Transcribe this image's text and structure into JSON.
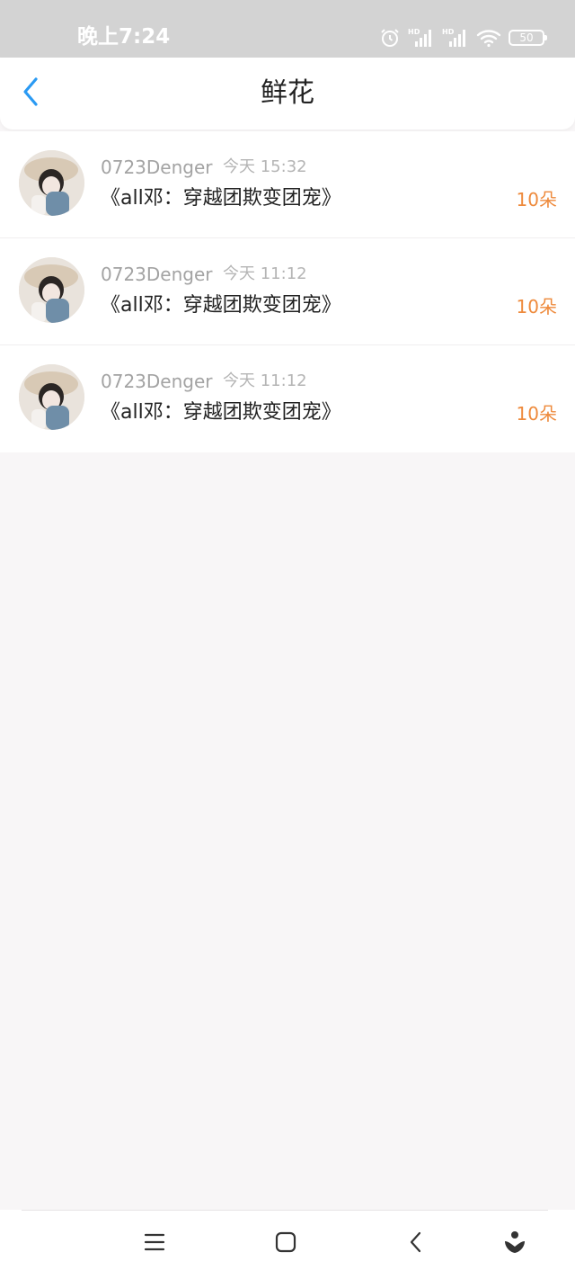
{
  "status_bar": {
    "time": "晚上7:24",
    "battery": "50",
    "icons": [
      "alarm-icon",
      "signal-hd-icon",
      "signal-hd-icon",
      "wifi-icon",
      "battery-icon"
    ]
  },
  "header": {
    "title": "鲜花",
    "back_icon": "chevron-left-icon"
  },
  "items": [
    {
      "user": "0723Denger",
      "time": "今天 15:32",
      "book": "《all邓：穿越团欺变团宠》",
      "count": "10朵"
    },
    {
      "user": "0723Denger",
      "time": "今天 11:12",
      "book": "《all邓：穿越团欺变团宠》",
      "count": "10朵"
    },
    {
      "user": "0723Denger",
      "time": "今天 11:12",
      "book": "《all邓：穿越团欺变团宠》",
      "count": "10朵"
    }
  ],
  "nav_bar": {
    "icons": [
      "menu-icon",
      "home-icon",
      "back-icon",
      "assistant-icon"
    ]
  },
  "colors": {
    "accent": "#2a9af3",
    "count": "#ee8a3c",
    "status_bar": "#d3d3d3",
    "background": "#f8f6f7"
  }
}
